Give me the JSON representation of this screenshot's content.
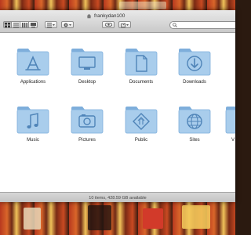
{
  "window": {
    "title": "frankydan100",
    "search": {
      "value": "",
      "placeholder": ""
    }
  },
  "toolbar": {
    "view_modes": [
      "icon-view",
      "list-view",
      "column-view",
      "cover-flow-view"
    ],
    "active_view": "icon-view"
  },
  "items": [
    {
      "label": "Applications",
      "icon": "applications-icon"
    },
    {
      "label": "Desktop",
      "icon": "desktop-icon"
    },
    {
      "label": "Documents",
      "icon": "documents-icon"
    },
    {
      "label": "Downloads",
      "icon": "downloads-icon"
    },
    {
      "label": "Music",
      "icon": "music-icon"
    },
    {
      "label": "Pictures",
      "icon": "pictures-icon"
    },
    {
      "label": "Public",
      "icon": "public-icon"
    },
    {
      "label": "Sites",
      "icon": "sites-icon"
    },
    {
      "label": "V",
      "icon": "videos-icon"
    }
  ],
  "status": {
    "text": "10 items, 428.59 GB available"
  },
  "colors": {
    "folder_light": "#a9cdec",
    "folder_dark": "#7eaedb",
    "folder_glyph": "#4f84b8"
  }
}
